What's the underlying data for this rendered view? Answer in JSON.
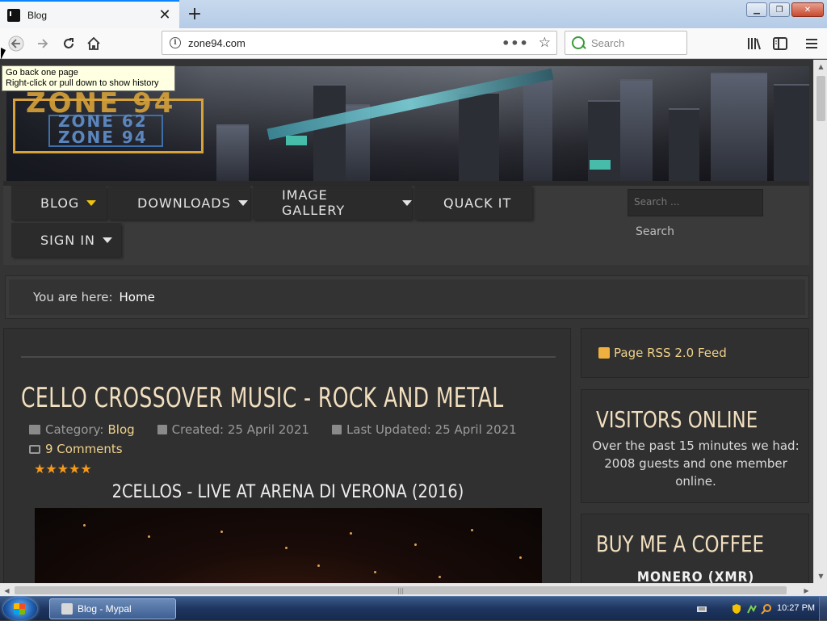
{
  "browser": {
    "tab_title": "Blog",
    "tab_close": "✕",
    "new_tab": "+",
    "url": "zone94.com",
    "search_placeholder": "Search",
    "tooltip_line1": "Go back one page",
    "tooltip_line2": "Right-click or pull down to show history"
  },
  "site": {
    "logo_main": "ZONE 94",
    "logo_sub1": "ZONE 62",
    "logo_sub2": "ZONE 94",
    "menu": [
      {
        "label": "BLOG"
      },
      {
        "label": "DOWNLOADS"
      },
      {
        "label": "IMAGE GALLERY"
      },
      {
        "label": "QUACK IT"
      },
      {
        "label": "SIGN IN"
      }
    ],
    "search_placeholder": "Search ...",
    "search_button": "Search",
    "breadcrumb_prefix": "You are here:",
    "breadcrumb_home": "Home"
  },
  "article": {
    "title": "CELLO CROSSOVER MUSIC - ROCK AND METAL",
    "category_label": "Category:",
    "category_value": "Blog",
    "created": "Created: 25 April 2021",
    "updated": "Last Updated: 25 April 2021",
    "comments": "9 Comments",
    "rating": "★★★★★",
    "video_title": "2CELLOS - LIVE AT ARENA DI VERONA (2016)"
  },
  "sidebar": {
    "rss": "Page RSS 2.0 Feed",
    "visitors_title": "VISITORS ONLINE",
    "visitors_text": "Over the past 15 minutes we had: 2008 guests and one member online.",
    "coffee_title": "BUY ME A COFFEE",
    "coffee_sub": "MONERO (XMR)"
  },
  "taskbar": {
    "window_label": "Blog - Mypal",
    "clock": "10:27 PM"
  }
}
